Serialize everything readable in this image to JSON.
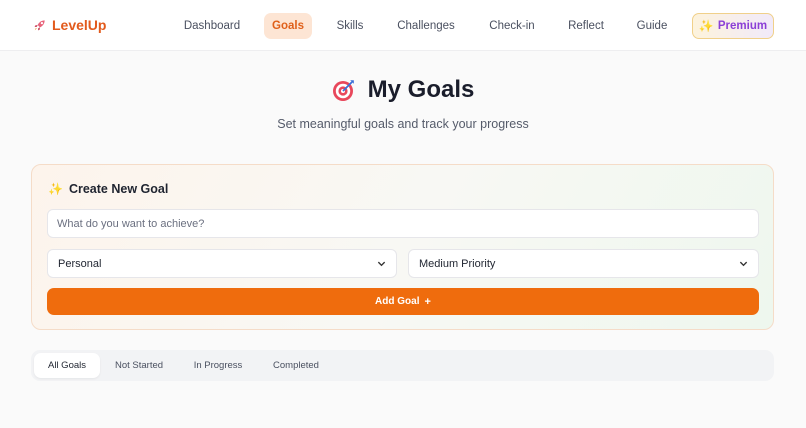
{
  "brand": {
    "name": "LevelUp",
    "icon": "rocket-icon",
    "color": "#e25a1c"
  },
  "nav": {
    "items": [
      {
        "label": "Dashboard",
        "active": false
      },
      {
        "label": "Goals",
        "active": true
      },
      {
        "label": "Skills",
        "active": false
      },
      {
        "label": "Challenges",
        "active": false
      },
      {
        "label": "Check-in",
        "active": false
      },
      {
        "label": "Reflect",
        "active": false
      },
      {
        "label": "Guide",
        "active": false
      }
    ],
    "premium_label": "Premium",
    "premium_icon": "sparkles-icon"
  },
  "page": {
    "icon": "target-icon",
    "title": "My Goals",
    "subtitle": "Set meaningful goals and track your progress"
  },
  "create_goal": {
    "title": "Create New Goal",
    "title_icon": "sparkles-icon",
    "input_placeholder": "What do you want to achieve?",
    "input_value": "",
    "category_select": "Personal",
    "priority_select": "Medium Priority",
    "add_button_label": "Add Goal",
    "add_button_icon": "plus-icon",
    "accent_color": "#ef6c0d"
  },
  "filters": {
    "tabs": [
      {
        "label": "All Goals",
        "active": true
      },
      {
        "label": "Not Started",
        "active": false
      },
      {
        "label": "In Progress",
        "active": false
      },
      {
        "label": "Completed",
        "active": false
      }
    ]
  }
}
